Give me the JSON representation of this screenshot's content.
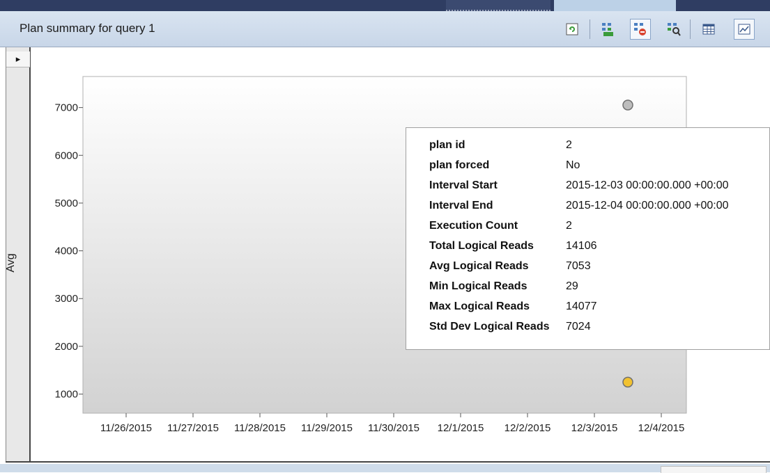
{
  "header": {
    "title": "Plan summary for query 1",
    "toolbar": [
      {
        "icon": "refresh-icon",
        "label": "Refresh"
      },
      {
        "icon": "force-plan-icon",
        "label": "Force Plan"
      },
      {
        "icon": "unforce-plan-icon",
        "label": "Unforce Plan"
      },
      {
        "icon": "compare-plans-icon",
        "label": "Compare Plans"
      },
      {
        "icon": "grid-view-icon",
        "label": "Grid view"
      },
      {
        "icon": "chart-view-icon",
        "label": "Chart view"
      }
    ]
  },
  "side": {
    "expander_glyph": "▸",
    "axis_label": "Avg"
  },
  "chart_data": {
    "type": "scatter",
    "title": "",
    "xlabel": "",
    "ylabel": "Avg",
    "categories": [
      "11/26/2015",
      "11/27/2015",
      "11/28/2015",
      "11/29/2015",
      "11/30/2015",
      "12/1/2015",
      "12/2/2015",
      "12/3/2015",
      "12/4/2015"
    ],
    "yticks": [
      1000,
      2000,
      3000,
      4000,
      5000,
      6000,
      7000
    ],
    "ylim": [
      600,
      7650
    ],
    "xlim": [
      "11/25/2015",
      "12/4/2015"
    ],
    "series": [
      {
        "points": [
          {
            "x": "12/3/2015 12:00",
            "y": 7053,
            "color": "#bdbdbd"
          },
          {
            "x": "12/3/2015 12:00",
            "y": 1250,
            "color": "#f2c230"
          }
        ]
      }
    ],
    "grid": false
  },
  "tooltip": {
    "rows": [
      {
        "label": "plan id",
        "value": "2"
      },
      {
        "label": "plan forced",
        "value": "No"
      },
      {
        "label": "Interval Start",
        "value": "2015-12-03 00:00:00.000 +00:00"
      },
      {
        "label": "Interval End",
        "value": "2015-12-04 00:00:00.000 +00:00"
      },
      {
        "label": "Execution Count",
        "value": "2"
      },
      {
        "label": "Total Logical Reads",
        "value": "14106"
      },
      {
        "label": "Avg Logical Reads",
        "value": "7053"
      },
      {
        "label": "Min Logical Reads",
        "value": "29"
      },
      {
        "label": "Max Logical Reads",
        "value": "14077"
      },
      {
        "label": "Std Dev Logical Reads",
        "value": "7024"
      }
    ]
  },
  "colors": {
    "title_bar": "#2f3d62",
    "header_bg": "#d0ddec",
    "point_gray": "#bdbdbd",
    "point_yellow": "#f2c230"
  }
}
